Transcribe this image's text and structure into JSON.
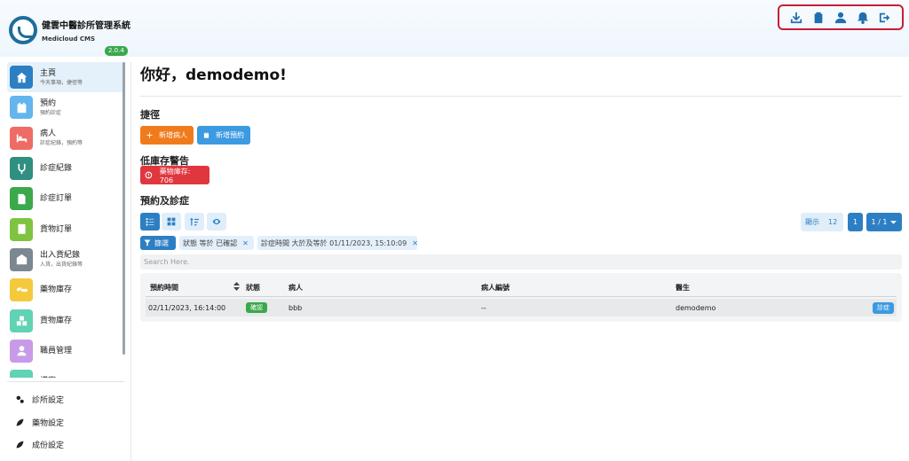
{
  "app": {
    "title": "健雲中醫診所管理系統",
    "subtitle": "Medicloud CMS",
    "version": "2.0.4"
  },
  "top_actions": [
    {
      "icon": "download-icon"
    },
    {
      "icon": "clipboard-icon"
    },
    {
      "icon": "user-icon"
    },
    {
      "icon": "bell-icon"
    },
    {
      "icon": "logout-icon"
    }
  ],
  "sidebar": {
    "items": [
      {
        "label": "主頁",
        "sub": "今天事項，捷徑等",
        "icon": "home-icon",
        "color": "#2d7fc4",
        "active": true
      },
      {
        "label": "預約",
        "sub": "預約診症",
        "icon": "calendar-icon",
        "color": "#64b5ee"
      },
      {
        "label": "病人",
        "sub": "診症紀錄，預約等",
        "icon": "bed-icon",
        "color": "#ef6b65"
      },
      {
        "label": "診症紀錄",
        "sub": "",
        "icon": "stethoscope-icon",
        "color": "#2f8f80"
      },
      {
        "label": "診症訂單",
        "sub": "",
        "icon": "document-icon",
        "color": "#3aa84b"
      },
      {
        "label": "貨物訂單",
        "sub": "",
        "icon": "receipt-icon",
        "color": "#80c341"
      },
      {
        "label": "出入貨紀錄",
        "sub": "入貨，出貨紀錄等",
        "icon": "warehouse-icon",
        "color": "#7b8791"
      },
      {
        "label": "藥物庫存",
        "sub": "",
        "icon": "pills-icon",
        "color": "#f4c93b"
      },
      {
        "label": "貨物庫存",
        "sub": "",
        "icon": "boxes-icon",
        "color": "#5fd3b3"
      },
      {
        "label": "職員管理",
        "sub": "",
        "icon": "staff-icon",
        "color": "#c89be8"
      },
      {
        "label": "檔案",
        "sub": "",
        "icon": "folder-icon",
        "color": "#5fd3b3"
      }
    ],
    "settings": [
      {
        "label": "診所設定",
        "icon": "gears-icon"
      },
      {
        "label": "藥物設定",
        "icon": "leaf-icon"
      },
      {
        "label": "成份設定",
        "icon": "leaf-icon"
      }
    ]
  },
  "main": {
    "greeting": "你好，demodemo!",
    "shortcuts_title": "捷徑",
    "new_patient": "新增病人",
    "new_appointment": "新增預約",
    "low_stock_title": "低庫存警告",
    "low_stock_badge": "藥物庫存: 706",
    "appointments_title": "預約及診症",
    "page_size_label": "顯示",
    "page_size": "12",
    "page_current": "1",
    "page_select": "1 / 1",
    "filter_label": "篩選",
    "chips": {
      "status": "狀態 等於 已確認",
      "time": "診症時間 大於及等於 01/11/2023, 15:10:09"
    },
    "search_placeholder": "Search Here.",
    "table": {
      "headers": {
        "time": "預約時間",
        "status": "狀態",
        "patient": "病人",
        "patient_no": "病人編號",
        "doctor": "醫生"
      },
      "rows": [
        {
          "time": "02/11/2023, 16:14:00",
          "status": "確認",
          "patient": "bbb",
          "patient_no": "--",
          "doctor": "demodemo",
          "action": "診症"
        }
      ]
    }
  }
}
